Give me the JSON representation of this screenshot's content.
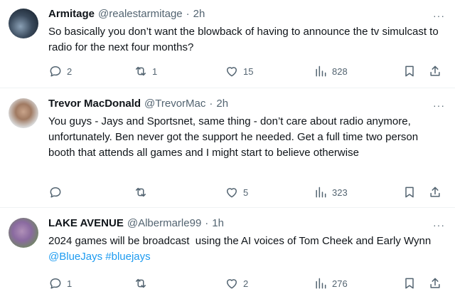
{
  "tweets": [
    {
      "name": "Armitage",
      "handle": "@realestarmitage",
      "separator": "·",
      "time": "2h",
      "more": "···",
      "text": "So basically you don’t want the blowback of having to announce the tv simulcast to radio for the next four months?",
      "links": "",
      "replies": "2",
      "reposts": "1",
      "likes": "15",
      "views": "828"
    },
    {
      "name": "Trevor MacDonald",
      "handle": "@TrevorMac",
      "separator": "·",
      "time": "2h",
      "more": "···",
      "text": "You guys - Jays and Sportsnet, same thing - don’t care about radio anymore, unfortunately. Ben never got the support he needed. Get a full time two person booth that attends all games and I might start to believe otherwise",
      "links": "",
      "replies": "",
      "reposts": "",
      "likes": "5",
      "views": "323"
    },
    {
      "name": "LAKE AVENUE",
      "handle": "@Albermarle99",
      "separator": "·",
      "time": "1h",
      "more": "···",
      "text": "2024 games will be broadcast  using the AI voices of Tom Cheek and Early Wynn ",
      "links": "@BlueJays #bluejays",
      "replies": "1",
      "reposts": "",
      "likes": "2",
      "views": "276"
    }
  ],
  "icons": {
    "reply": "reply-icon",
    "repost": "repost-icon",
    "like": "heart-icon",
    "views": "views-chart-icon",
    "bookmark": "bookmark-icon",
    "share": "share-icon"
  },
  "colors": {
    "text": "#0f1419",
    "secondary": "#536471",
    "link": "#1d9bf0",
    "divider": "#eff3f4"
  }
}
